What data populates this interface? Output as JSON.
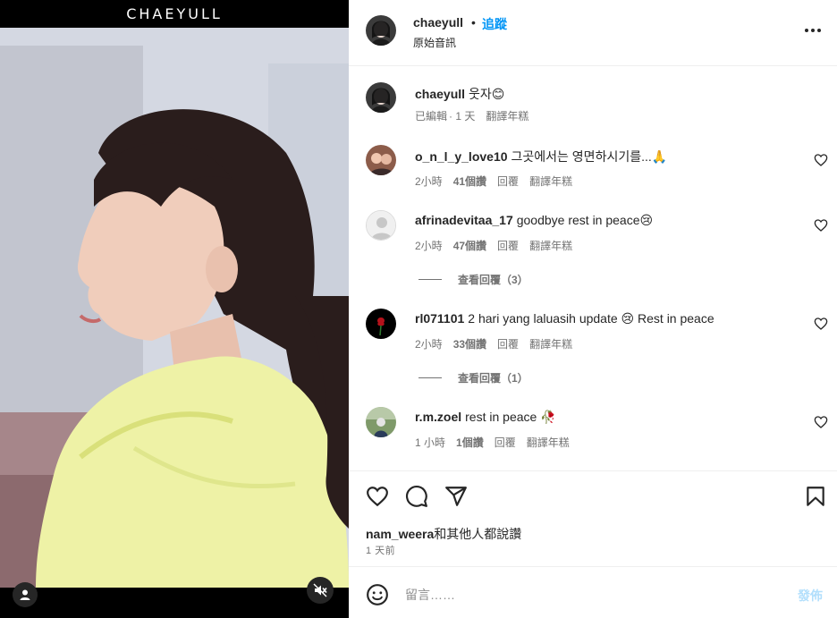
{
  "media": {
    "brand_title": "CHAEYULL"
  },
  "header": {
    "username": "chaeyull",
    "separator": "•",
    "follow_label": "追蹤",
    "subtitle": "原始音訊"
  },
  "caption": {
    "username": "chaeyull",
    "text": "웃자😊",
    "edited": "已編輯",
    "time": "· 1 天",
    "translate": "翻譯年糕"
  },
  "comments": [
    {
      "username": "o_n_l_y_love10",
      "text": "그곳에서는 영면하시기를...🙏",
      "time": "2小時",
      "likes": "41個讚",
      "reply": "回覆",
      "translate": "翻譯年糕"
    },
    {
      "username": "afrinadevitaa_17",
      "text": "goodbye rest in peace😢",
      "time": "2小時",
      "likes": "47個讚",
      "reply": "回覆",
      "translate": "翻譯年糕",
      "view_replies": "查看回覆（3）"
    },
    {
      "username": "rl071101",
      "text": "2 hari yang laluasih update 😢 Rest in peace",
      "time": "2小時",
      "likes": "33個讚",
      "reply": "回覆",
      "translate": "翻譯年糕",
      "view_replies": "查看回覆（1）"
    },
    {
      "username": "r.m.zoel",
      "text": "rest in peace 🥀",
      "time": "1 小時",
      "likes": "1個讚",
      "reply": "回覆",
      "translate": "翻譯年糕"
    }
  ],
  "likes_line": {
    "username": "nam_weera",
    "suffix": "和其他人都說讚"
  },
  "time_ago": "1 天前",
  "composer": {
    "placeholder": "留言……",
    "post_label": "發佈"
  },
  "colors": {
    "accent": "#0095f6",
    "post_disabled": "#b2dffc",
    "muted_text": "#737373"
  }
}
